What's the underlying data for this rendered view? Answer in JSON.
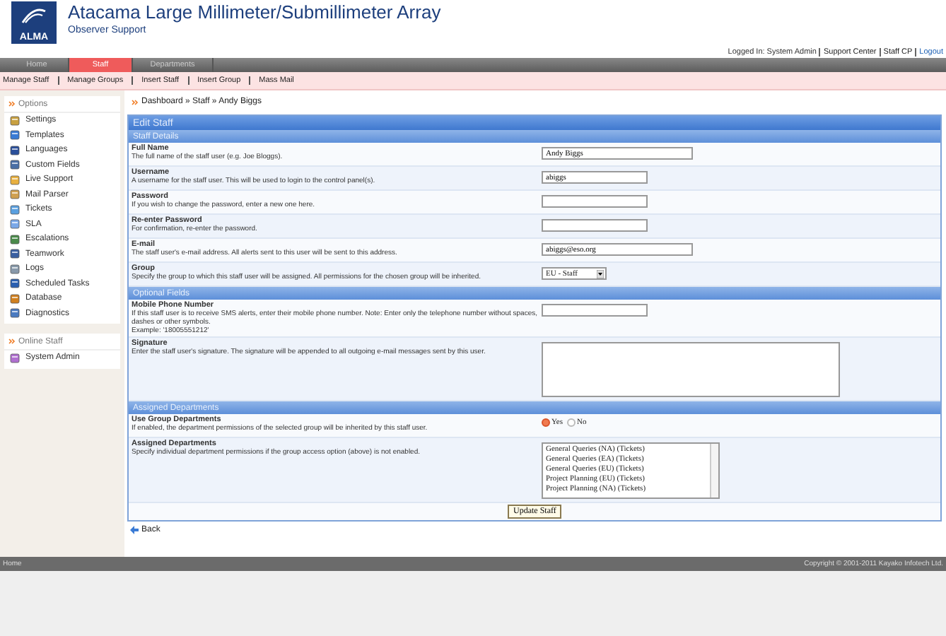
{
  "header": {
    "logo_text": "ALMA",
    "title": "Atacama Large Millimeter/Submillimeter Array",
    "subtitle": "Observer Support"
  },
  "user_bar": {
    "logged_in": "Logged In: System Admin",
    "links": [
      "Support Center",
      "Staff CP",
      "Logout"
    ]
  },
  "nav": {
    "tabs": [
      {
        "label": "Home",
        "selected": false
      },
      {
        "label": "Staff",
        "selected": true
      },
      {
        "label": "Departments",
        "selected": false
      }
    ]
  },
  "subnav": [
    "Manage Staff",
    "Manage Groups",
    "Insert Staff",
    "Insert Group",
    "Mass Mail"
  ],
  "sidebar": {
    "panels": [
      {
        "title": "Options",
        "items": [
          "Settings",
          "Templates",
          "Languages",
          "Custom Fields",
          "Live Support",
          "Mail Parser",
          "Tickets",
          "SLA",
          "Escalations",
          "Teamwork",
          "Logs",
          "Scheduled Tasks",
          "Database",
          "Diagnostics"
        ]
      },
      {
        "title": "Online Staff",
        "items": [
          "System Admin"
        ]
      }
    ]
  },
  "breadcrumb": "Dashboard » Staff » Andy Biggs",
  "form": {
    "title": "Edit Staff",
    "sections": [
      {
        "title": "Staff Details",
        "rows": [
          {
            "kind": "text",
            "label": "Full Name",
            "description": "The full name of the staff user (e.g. Joe Bloggs).",
            "value": "Andy Biggs"
          },
          {
            "kind": "short",
            "label": "Username",
            "description": "A username for the staff user. This will be used to login to the control panel(s).",
            "value": "abiggs"
          },
          {
            "kind": "short",
            "label": "Password",
            "description": "If you wish to change the password, enter a new one here."
          },
          {
            "kind": "short",
            "label": "Re-enter Password",
            "description": "For confirmation, re-enter the password."
          },
          {
            "kind": "text",
            "label": "E-mail",
            "description": "The staff user's e-mail address.  All alerts sent to this user will be sent to this address.",
            "value": "abiggs@eso.org"
          },
          {
            "kind": "select",
            "label": "Group",
            "description": "Specify the group to which this staff user will be assigned. All permissions for the chosen group will be inherited.",
            "value": "EU - Staff"
          }
        ]
      },
      {
        "title": "Optional Fields",
        "rows": [
          {
            "kind": "short",
            "label": "Mobile Phone Number",
            "description": "If this staff user is to receive SMS alerts, enter their mobile phone number. Note: Enter only the telephone number without spaces, dashes or other symbols.",
            "example": "Example: '18005551212'"
          },
          {
            "kind": "textarea",
            "label": "Signature",
            "description": "Enter the staff user's signature. The signature will be appended to all outgoing e-mail messages sent by this user."
          }
        ]
      },
      {
        "title": "Assigned Departments",
        "rows": [
          {
            "kind": "radio",
            "label": "Use Group Departments",
            "description": "If enabled, the department permissions of the selected group will be inherited by this staff user.",
            "options": [
              {
                "label": "Yes",
                "selected": true
              },
              {
                "label": "No",
                "selected": false
              }
            ]
          },
          {
            "kind": "listbox",
            "label": "Assigned Departments",
            "description": "Specify individual department permissions if the group access option (above) is not enabled.",
            "options": [
              "General Queries (NA) (Tickets)",
              "General Queries (EA) (Tickets)",
              "General Queries (EU) (Tickets)",
              "Project Planning (EU) (Tickets)",
              "Project Planning (NA) (Tickets)"
            ]
          }
        ]
      }
    ],
    "submit": "Update Staff"
  },
  "back": "Back",
  "footer": {
    "left": "Home",
    "right": "Copyright © 2001-2011 Kayako Infotech Ltd."
  }
}
